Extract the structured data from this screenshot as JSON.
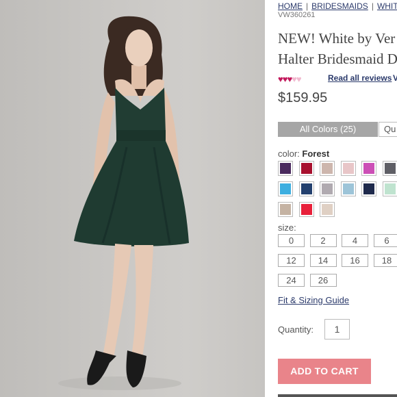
{
  "breadcrumb": {
    "items": [
      "HOME",
      "BRIDESMAIDS",
      "WHITE"
    ],
    "separator": "|"
  },
  "sku": "VW360261",
  "title": {
    "line1": "NEW! White by Ver",
    "line2": "Halter Bridesmaid D"
  },
  "rating": {
    "filled": 3,
    "total": 5,
    "star_char": "♥",
    "on_color": "#c2185b",
    "off_color": "#f1b9cf"
  },
  "reviews_link": "Read all reviews",
  "reviews_link_overflow": "V",
  "price": "$159.95",
  "tabs": {
    "all_colors": "All Colors (25)",
    "quick": "Qu"
  },
  "color": {
    "label": "color:",
    "selected": "Forest"
  },
  "swatches": [
    "#4a2a5e",
    "#a8102e",
    "#cdb6ad",
    "#e8c6c8",
    "#cc4fb6",
    "#5f5f66",
    "#f08b7e",
    "#3daee0",
    "#23406e",
    "#b0aab0",
    "#9dc4d8",
    "#1f2a4c",
    "#bfe3cf",
    "#fbeef0",
    "#c5b3a3",
    "#e8203a",
    "#dfd0c4"
  ],
  "size": {
    "label": "size:",
    "options": [
      "0",
      "2",
      "4",
      "6",
      "12",
      "14",
      "16",
      "18",
      "24",
      "26"
    ]
  },
  "fit_guide": "Fit & Sizing Guide",
  "quantity": {
    "label": "Quantity:",
    "value": "1"
  },
  "add_to_cart": "ADD TO CART",
  "colors": {
    "accent_button": "#e9848a",
    "link": "#2b3a6b",
    "dress": "#1f3b31"
  }
}
